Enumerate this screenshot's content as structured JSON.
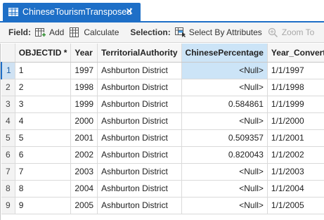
{
  "tab": {
    "title": "ChineseTourismTransposed",
    "close": "✕"
  },
  "toolbar": {
    "field_label": "Field:",
    "add_label": "Add",
    "calculate_label": "Calculate",
    "selection_label": "Selection:",
    "select_by_attributes_label": "Select By Attributes",
    "zoom_to_label": "Zoom To"
  },
  "table": {
    "columns": [
      "OBJECTID *",
      "Year",
      "TerritorialAuthority",
      "ChinesePercentage",
      "Year_Converted"
    ],
    "rows": [
      {
        "rownum": "1",
        "objectid": "1",
        "year": "1997",
        "authority": "Ashburton District",
        "pct": "<Null>",
        "converted": "1/1/1997"
      },
      {
        "rownum": "2",
        "objectid": "2",
        "year": "1998",
        "authority": "Ashburton District",
        "pct": "<Null>",
        "converted": "1/1/1998"
      },
      {
        "rownum": "3",
        "objectid": "3",
        "year": "1999",
        "authority": "Ashburton District",
        "pct": "0.584861",
        "converted": "1/1/1999"
      },
      {
        "rownum": "4",
        "objectid": "4",
        "year": "2000",
        "authority": "Ashburton District",
        "pct": "<Null>",
        "converted": "1/1/2000"
      },
      {
        "rownum": "5",
        "objectid": "5",
        "year": "2001",
        "authority": "Ashburton District",
        "pct": "0.509357",
        "converted": "1/1/2001"
      },
      {
        "rownum": "6",
        "objectid": "6",
        "year": "2002",
        "authority": "Ashburton District",
        "pct": "0.820043",
        "converted": "1/1/2002"
      },
      {
        "rownum": "7",
        "objectid": "7",
        "year": "2003",
        "authority": "Ashburton District",
        "pct": "<Null>",
        "converted": "1/1/2003"
      },
      {
        "rownum": "8",
        "objectid": "8",
        "year": "2004",
        "authority": "Ashburton District",
        "pct": "<Null>",
        "converted": "1/1/2004"
      },
      {
        "rownum": "9",
        "objectid": "9",
        "year": "2005",
        "authority": "Ashburton District",
        "pct": "<Null>",
        "converted": "1/1/2005"
      }
    ]
  },
  "colors": {
    "accent": "#1e6fc7",
    "selection": "#cce4f7"
  }
}
